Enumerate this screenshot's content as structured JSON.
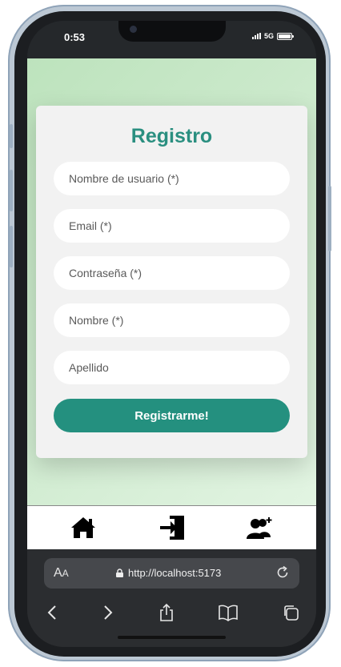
{
  "status": {
    "time": "0:53",
    "network": "5G"
  },
  "form": {
    "title": "Registro",
    "username_placeholder": "Nombre de usuario (*)",
    "email_placeholder": "Email (*)",
    "password_placeholder": "Contraseña (*)",
    "name_placeholder": "Nombre (*)",
    "lastname_placeholder": "Apellido",
    "submit_label": "Registrarme!"
  },
  "tabbar": {
    "icons": [
      "home-icon",
      "login-icon",
      "add-user-icon"
    ]
  },
  "browser": {
    "aa_big": "A",
    "aa_small": "A",
    "url": "http://localhost:5173"
  },
  "colors": {
    "accent": "#24907f",
    "title": "#2a8f80",
    "card": "#f2f2f2"
  }
}
